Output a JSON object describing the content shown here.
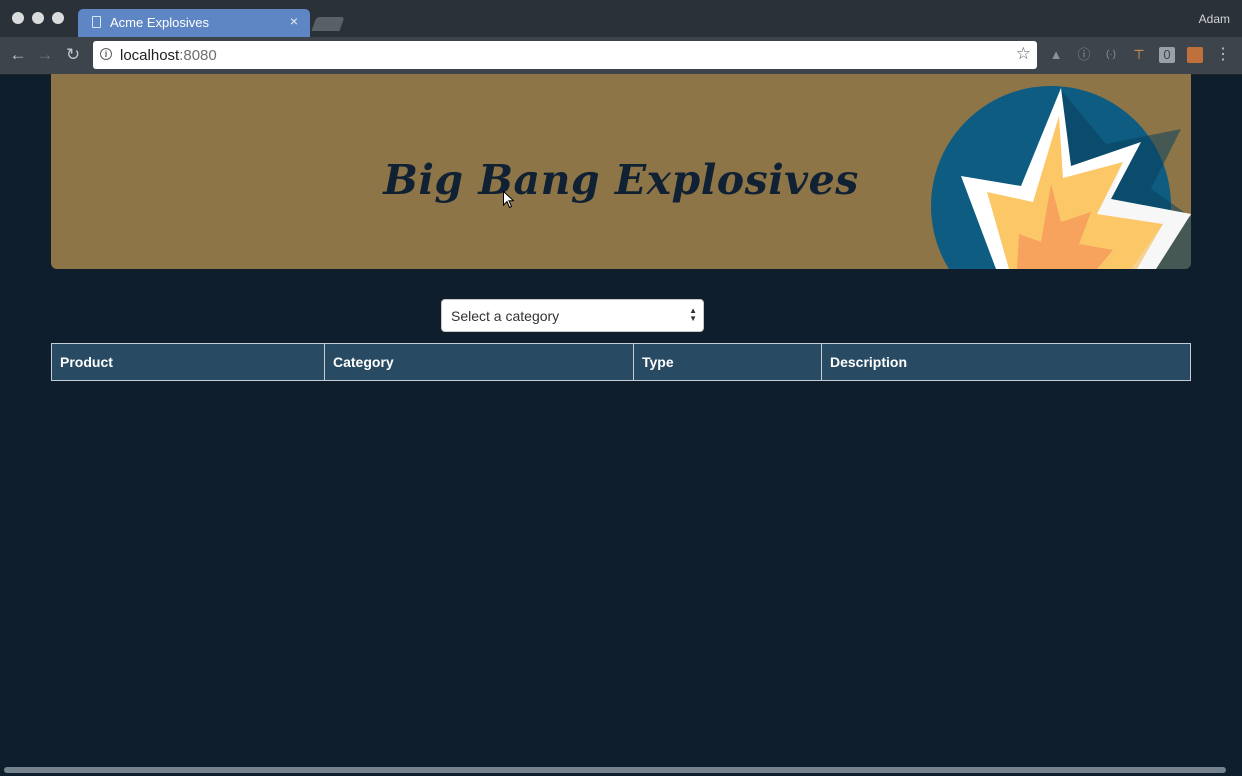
{
  "browser": {
    "tab_title": "Acme Explosives",
    "tab_close": "×",
    "profile_name": "Adam",
    "url_host": "localhost",
    "url_port": ":8080"
  },
  "banner": {
    "title": "Big Bang Explosives",
    "background_color": "#8e7548",
    "title_color": "#102134"
  },
  "category_select": {
    "placeholder": "Select a category",
    "options": [
      "Select a category"
    ]
  },
  "products_table": {
    "columns": [
      "Product",
      "Category",
      "Type",
      "Description"
    ],
    "rows": []
  },
  "colors": {
    "page_background": "#0f1e2d",
    "table_header_background": "#294a63",
    "tab_active": "#5f86c4"
  }
}
